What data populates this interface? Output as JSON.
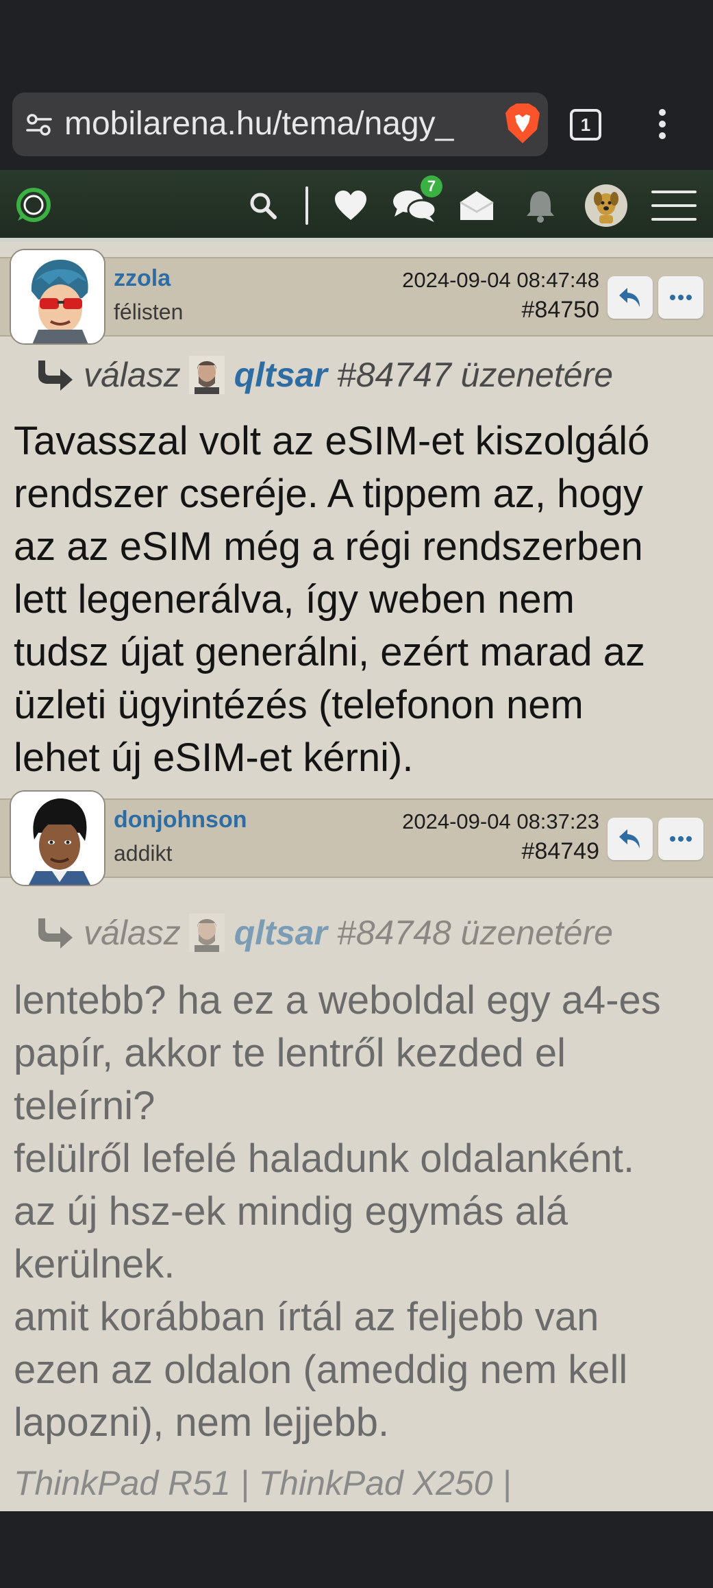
{
  "browser": {
    "url": "mobilarena.hu/tema/nagy_",
    "tab_count": "1"
  },
  "header": {
    "chat_badge": "7",
    "icons": [
      "logo-icon",
      "search-icon",
      "heart-icon",
      "chat-icon",
      "mail-icon",
      "bell-icon",
      "user-avatar-icon",
      "menu-icon"
    ]
  },
  "posts": [
    {
      "username": "zzola",
      "rank": "félisten",
      "date": "2024-09-04 08:47:48",
      "number": "#84750",
      "reply_prefix": "válasz",
      "reply_user": "qltsar",
      "reply_suffix": "#84747 üzenetére",
      "body": "Tavasszal volt az eSIM-et kiszolgáló\nrendszer cseréje. A tippem az, hogy\naz az eSIM még a régi rendszerben\nlett legenerálva, így weben nem\ntudsz újat generálni, ezért marad az\nüzleti ügyintézés (telefonon nem\nlehet új eSIM-et kérni)."
    },
    {
      "username": "donjohnson",
      "rank": "addikt",
      "date": "2024-09-04 08:37:23",
      "number": "#84749",
      "reply_prefix": "válasz",
      "reply_user": "qltsar",
      "reply_suffix": "#84748 üzenetére",
      "body": "lentebb? ha ez a weboldal egy a4-es\npapír, akkor te lentről kezded el\nteleírni?\nfelülről lefelé haladunk oldalanként.\naz új hsz-ek mindig egymás alá\nkerülnek.\namit korábban írtál az feljebb van\nezen az oldalon (ameddig nem kell\nlapozni), nem lejjebb.",
      "signature": "ThinkPad R51 | ThinkPad X250 |"
    }
  ],
  "colors": {
    "accent_blue": "#2e6da4",
    "header_green": "#2a3a2c",
    "badge_green": "#3bb143",
    "content_bg": "#dbd6cb",
    "post_head_bg": "#c9c2b1"
  }
}
